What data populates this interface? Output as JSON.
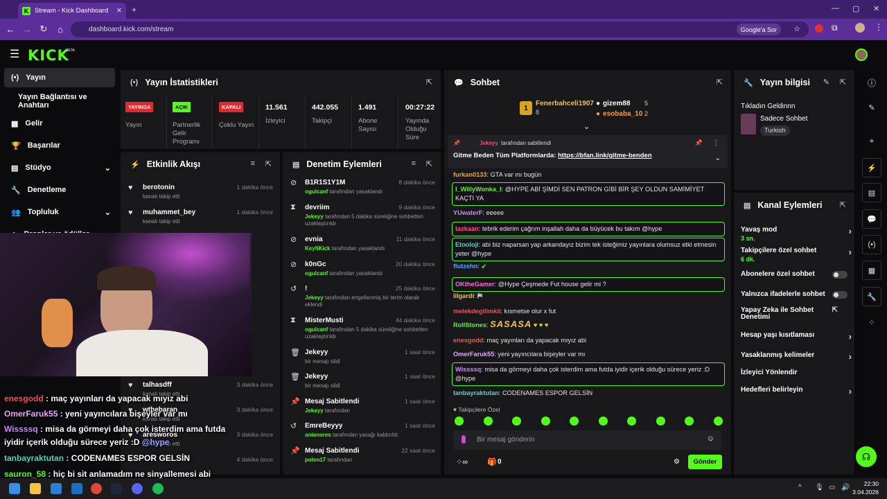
{
  "browser": {
    "tab_title": "Stream - Kick Dashboard",
    "url": "dashboard.kick.com/stream",
    "google_btn": "Google'a Sor"
  },
  "header": {
    "logo": "KICK",
    "beta": "BETA"
  },
  "sidebar": {
    "items": [
      {
        "label": "Yayın"
      },
      {
        "label": "Yayın Bağlantısı ve Anahtarı"
      },
      {
        "label": "Gelir"
      },
      {
        "label": "Başarılar"
      },
      {
        "label": "Stüdyo"
      },
      {
        "label": "Denetleme"
      },
      {
        "label": "Topluluk"
      },
      {
        "label": "Droplar ve ödüller"
      }
    ]
  },
  "stats": {
    "title": "Yayın İstatistikleri",
    "items": [
      {
        "badge": "YAYINDA",
        "label": "Yayın",
        "color": "#e8262c"
      },
      {
        "badge": "AÇIK",
        "label": "Partnerlik Gelir Programı",
        "color": "#53fc18"
      },
      {
        "badge": "KAPALI",
        "label": "Çoklu Yayın",
        "color": "#e8262c"
      },
      {
        "value": "11.561",
        "label": "İzleyici"
      },
      {
        "value": "442.055",
        "label": "Takipçi"
      },
      {
        "value": "1.491",
        "label": "Abone Sayısı"
      },
      {
        "value": "00:27:22",
        "label": "Yayında Olduğu Süre"
      }
    ]
  },
  "activity": {
    "title": "Etkinlik Akışı",
    "items": [
      {
        "name": "berotonin",
        "sub": "kanalı takip etti",
        "time": "1 dakika önce"
      },
      {
        "name": "muhammet_bey",
        "sub": "kanalı takip etti",
        "time": "1 dakika önce"
      },
      {
        "name": "talhasdff",
        "sub": "kanalı takip etti",
        "time": "3 dakika önce"
      },
      {
        "name": "wthebaran",
        "sub": "kanalı takip etti",
        "time": "3 dakika önce"
      },
      {
        "name": "aresworos",
        "sub": "kanalı takip etti",
        "time": "3 dakika önce"
      },
      {
        "name": "",
        "sub": "",
        "time": "4 dakika önce"
      }
    ]
  },
  "moderation": {
    "title": "Denetim Eylemleri",
    "items": [
      {
        "icon": "⊘",
        "name": "B1R1S1Y1M",
        "mod": "ogulcanf",
        "sub": " tarafından yasaklandı",
        "time": "8 dakika önce"
      },
      {
        "icon": "⧗",
        "name": "devriim",
        "mod": "Jekeyy",
        "sub": " tarafından 5 dakika süreliğine sohbetten uzaklaştırıldı",
        "time": "9 dakika önce"
      },
      {
        "icon": "⊘",
        "name": "evnia",
        "mod": "KeyfiKick",
        "sub": " tarafından yasaklandı",
        "time": "11 dakika önce"
      },
      {
        "icon": "⊘",
        "name": "k0nGc",
        "mod": "ogulcanf",
        "sub": " tarafından yasaklandı",
        "time": "20 dakika önce"
      },
      {
        "icon": "↺",
        "name": "!",
        "mod": "Jekeyy",
        "sub": " tarafından engellenmiş bir terim olarak eklendi",
        "time": "25 dakika önce"
      },
      {
        "icon": "⧗",
        "name": "MisterMusti",
        "mod": "ogulcanf",
        "sub": " tarafından 5 dakika süreliğine sohbetten uzaklaştırıldı",
        "time": "44 dakika önce"
      },
      {
        "icon": "🗑",
        "name": "Jekeyy",
        "mod": "",
        "sub": "bir mesajı sildi",
        "time": "1 saat önce"
      },
      {
        "icon": "🗑",
        "name": "Jekeyy",
        "mod": "",
        "sub": "bir mesajı sildi",
        "time": "1 saat önce"
      },
      {
        "icon": "📌",
        "name": "Mesaj Sabitlendi",
        "mod": "Jekeyy",
        "sub": " tarafından",
        "time": "1 saat önce"
      },
      {
        "icon": "↺",
        "name": "EmreBeyyy",
        "mod": "anianores",
        "sub": " tarafından yasağı kaldırıldı",
        "time": "1 saat önce"
      },
      {
        "icon": "📌",
        "name": "Mesaj Sabitlendi",
        "mod": "polen17",
        "sub": " tarafından",
        "time": "22 saat önce"
      }
    ]
  },
  "chat": {
    "title": "Sohbet",
    "top": [
      {
        "rank": "1",
        "name": "Fenerbahceli1907",
        "count": "8"
      },
      {
        "name": "gizem88",
        "count": "5"
      },
      {
        "name": "esobaba_10",
        "count": "2"
      }
    ],
    "pinned": {
      "by": "Jekeyy",
      "by_suffix": "tarafından sabitlendi",
      "text": "Gitme Beden Tüm Platformlarda: ",
      "link": "https://bfan.link/gitme-benden"
    },
    "messages": [
      {
        "user": "furkan0133",
        "color": "#f0a050",
        "text": "GTA var mı bugün"
      },
      {
        "user": "I_WillyWonka_I",
        "color": "#53fc18",
        "text": "@HYPE ABİ ŞİMDİ SEN PATRON GİBİ BİR ŞEY OLDUN SAMİMİYET KAÇTI YA"
      },
      {
        "user": "YUwaterF",
        "color": "#c98bff",
        "text": "eeeee"
      },
      {
        "user": "tazkaan",
        "color": "#ff4b7d",
        "text": "tebrik ederim çağrım inşallah daha da büyücek bu takım @hype"
      },
      {
        "user": "Etooloji",
        "color": "#4fd6c7",
        "text": "abi biz naparsan yap arkandayız bizim tek isteğimiz yayınlara olumsuz etki etmesin yeter @hype"
      },
      {
        "user": "flutzehn",
        "color": "#5aa0ff",
        "text": ""
      },
      {
        "user": "OKtheGamer",
        "color": "#ff6ad5",
        "text": "@Hype Çeşmede Fut house gelir mi ?"
      },
      {
        "user": "lilgardi",
        "color": "#f5c242",
        "text": ""
      },
      {
        "user": "melekdegilimkii",
        "color": "#ff4b4b",
        "text": "kısmetse olur x fut"
      },
      {
        "user": "RollStones",
        "color": "#53fc18",
        "text": ""
      },
      {
        "user": "enesgodd",
        "color": "#ff4b4b",
        "text": "maç yayınları da yapacak mıyız abi"
      },
      {
        "user": "OmerFaruk55",
        "color": "#e7a6ff",
        "text": "yeni yayıncılara bişeyler var mı"
      },
      {
        "user": "Wissssq",
        "color": "#c98bff",
        "text": "misa da görmeyi daha çok isterdim ama futda iyidir içerik olduğu sürece yeriz :D @hype"
      },
      {
        "user": "tanbayraktutan",
        "color": "#4fd6c7",
        "text": "CODENAMES ESPOR GELSİN"
      }
    ],
    "rollstones_text": "SASASA",
    "followers_only": "Takipçilere Özel",
    "input_placeholder": "Bir mesaj gönderin",
    "points": "0",
    "send": "Gönder"
  },
  "stream_info": {
    "title": "Yayın bilgisi",
    "stream_title": "Tıkladın Geldinnn",
    "category": "Sadece Sohbet",
    "tag": "Turkish"
  },
  "channel_actions": {
    "title": "Kanal Eylemleri",
    "items": [
      {
        "label": "Yavaş mod",
        "value": "3 sn.",
        "kind": "chev"
      },
      {
        "label": "Takipçilere özel sohbet",
        "value": "6 dk.",
        "kind": "chev"
      },
      {
        "label": "Abonelere özel sohbet",
        "kind": "toggle"
      },
      {
        "label": "Yalnızca ifadelerle sohbet",
        "kind": "toggle"
      },
      {
        "label": "Yapay Zeka ile Sohbet Denetimi",
        "kind": "ext"
      },
      {
        "label": "Hesap yaşı kısıtlaması",
        "kind": "chev"
      },
      {
        "label": "Yasaklanmış kelimeler",
        "kind": "chev"
      },
      {
        "label": "İzleyici Yönlendir",
        "kind": "none"
      },
      {
        "label": "Hedefleri belirleyin",
        "kind": "chev"
      }
    ]
  },
  "overlay_chat": [
    {
      "user": "enesgodd",
      "color": "#ff4b4b",
      "text": "maç yayınları da yapacak mıyız abi"
    },
    {
      "user": "OmerFaruk55",
      "color": "#e7a6ff",
      "text": "yeni yayıncılara bişeyler var mı"
    },
    {
      "user": "Wissssq",
      "color": "#c98bff",
      "text": "misa da görmeyi daha çok isterdim ama futda"
    },
    {
      "user": "",
      "color": "#fff",
      "text": "iyidir içerik olduğu sürece yeriz :D",
      "mention": "@hype"
    },
    {
      "user": "tanbayraktutan",
      "color": "#4fd6c7",
      "text": "CODENAMES ESPOR GELSİN"
    },
    {
      "user": "sauron_58",
      "color": "#53fc18",
      "text": "hiç bi sit anlamadım ne sinyallemesi abi"
    }
  ],
  "taskbar": {
    "time": "22:30",
    "date": "3.04.2026"
  }
}
